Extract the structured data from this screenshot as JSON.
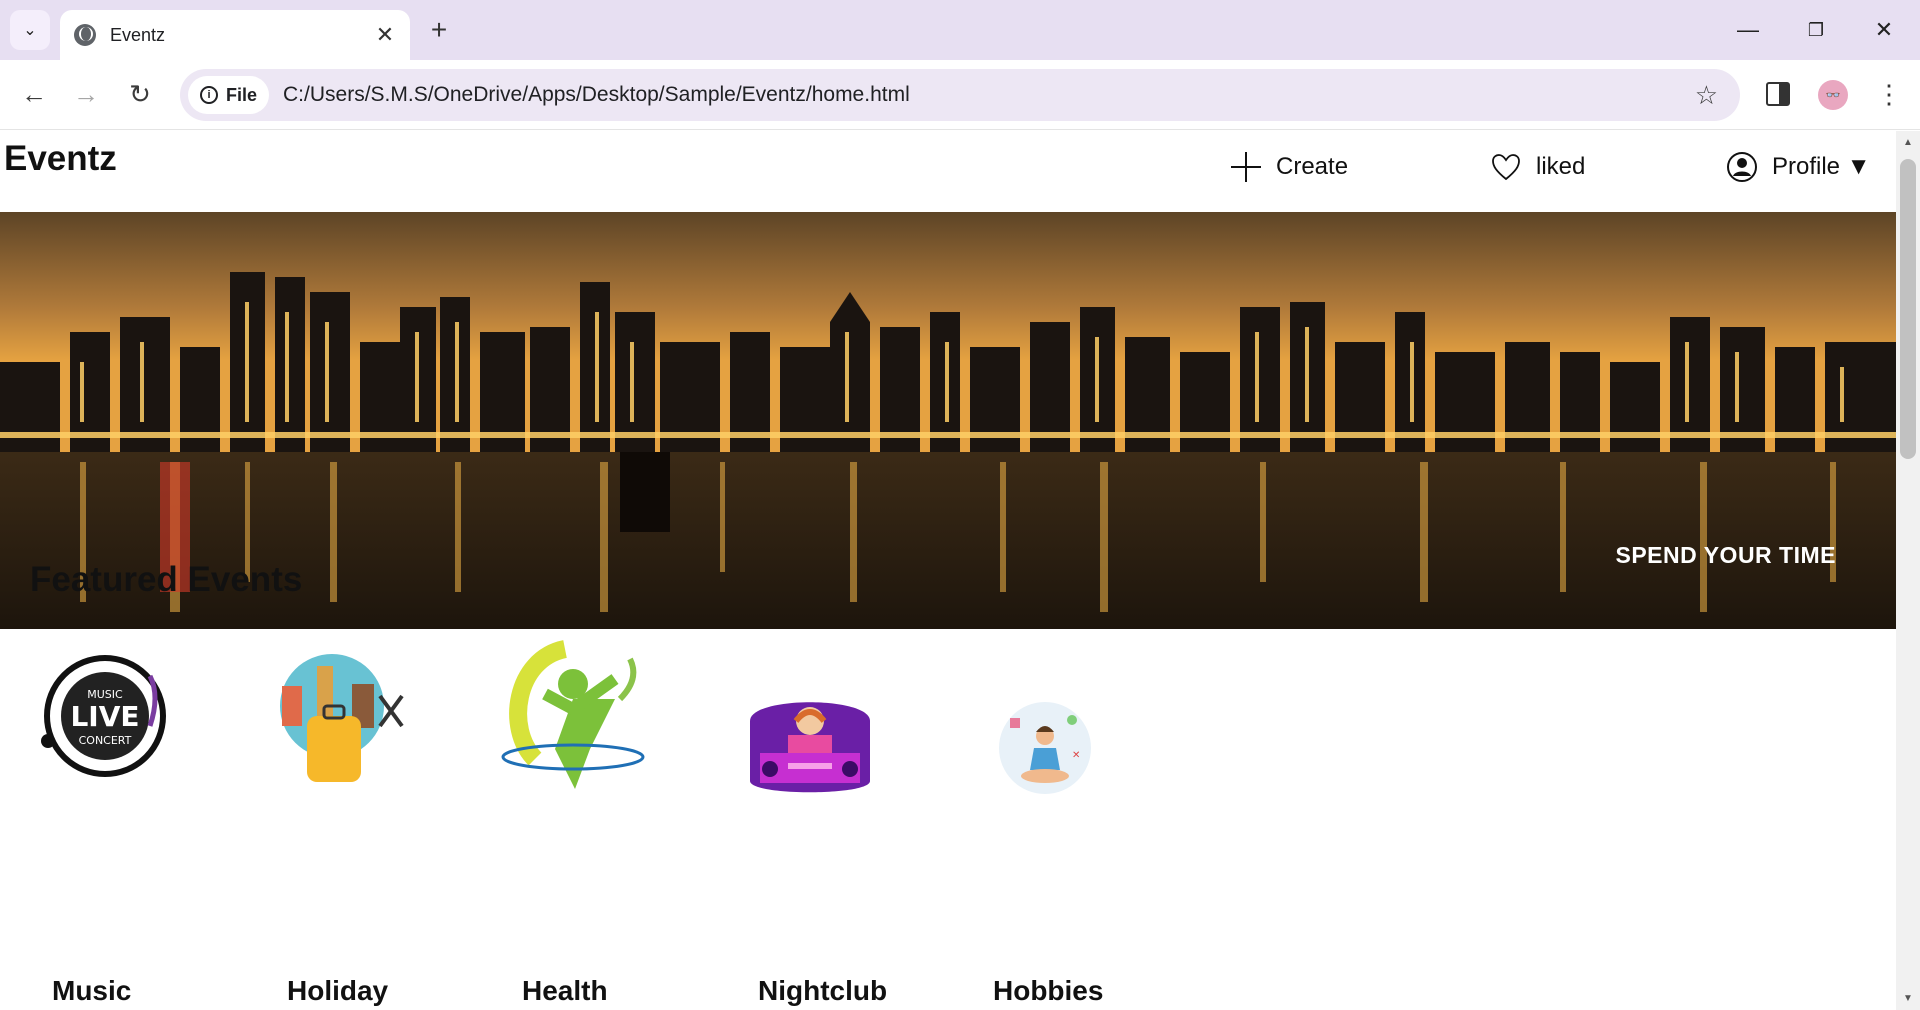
{
  "browser": {
    "tab_title": "Eventz",
    "url_chip": "File",
    "url": "C:/Users/S.M.S/OneDrive/Apps/Desktop/Sample/Eventz/home.html"
  },
  "site": {
    "brand": "Eventz",
    "nav": {
      "create_label": "Create",
      "liked_label": "liked",
      "profile_label": "Profile ▼"
    },
    "hero": {
      "tagline": "SPEND YOUR TIME"
    },
    "featured": {
      "title": "Featured Events",
      "categories": [
        {
          "label": "Music",
          "icon": "live-concert-icon"
        },
        {
          "label": "Holiday",
          "icon": "travel-suitcase-icon"
        },
        {
          "label": "Health",
          "icon": "health-person-icon"
        },
        {
          "label": "Nightclub",
          "icon": "dj-icon"
        },
        {
          "label": "Hobbies",
          "icon": "meditation-icon"
        }
      ]
    }
  },
  "colors": {
    "chrome_tabbar": "#e7dff2",
    "omnibox": "#ede7f4",
    "text": "#111111"
  }
}
